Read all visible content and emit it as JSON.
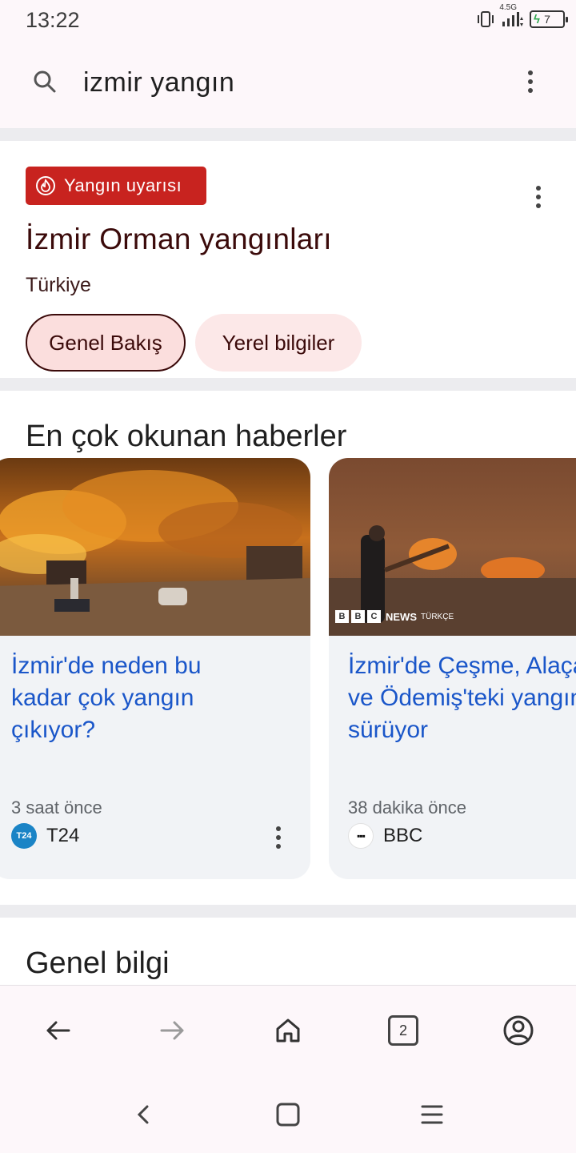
{
  "status_bar": {
    "time": "13:22",
    "network": "4.5G",
    "battery": "7",
    "icons": [
      "vibrate-icon",
      "signal-icon",
      "battery-icon"
    ]
  },
  "search": {
    "query": "izmir yangın",
    "icon": "search-icon"
  },
  "alert": {
    "badge_label": "Yangın uyarısı",
    "title": "İzmir Orman yangınları",
    "subtitle": "Türkiye",
    "tabs": [
      {
        "label": "Genel Bakış",
        "selected": true
      },
      {
        "label": "Yerel bilgiler",
        "selected": false
      }
    ],
    "accent_color": "#c8231f"
  },
  "news": {
    "heading": "En çok okunan haberler",
    "cards": [
      {
        "title": "İzmir'de neden bu\nkadar çok yangın\nçıkıyor?",
        "time": "3 saat önce",
        "source": "T24",
        "logo_text": "T24"
      },
      {
        "title": "İzmir'de Çeşme, Alaçatı\nve Ödemiş'teki yangınlar\nsürüyor",
        "time": "38 dakika önce",
        "source": "BBC",
        "logo_text": "▪▪▪",
        "image_badge": {
          "b1": "B",
          "b2": "B",
          "b3": "C",
          "news": "NEWS",
          "lang": "TÜRKÇE"
        }
      }
    ]
  },
  "info": {
    "heading": "Genel bilgi"
  },
  "toolbar": {
    "tab_count": "2",
    "items": [
      "back-icon",
      "forward-icon",
      "home-icon",
      "tabs-icon",
      "account-icon"
    ]
  },
  "navbar": {
    "items": [
      "nav-back-icon",
      "nav-home-icon",
      "nav-menu-icon"
    ]
  }
}
